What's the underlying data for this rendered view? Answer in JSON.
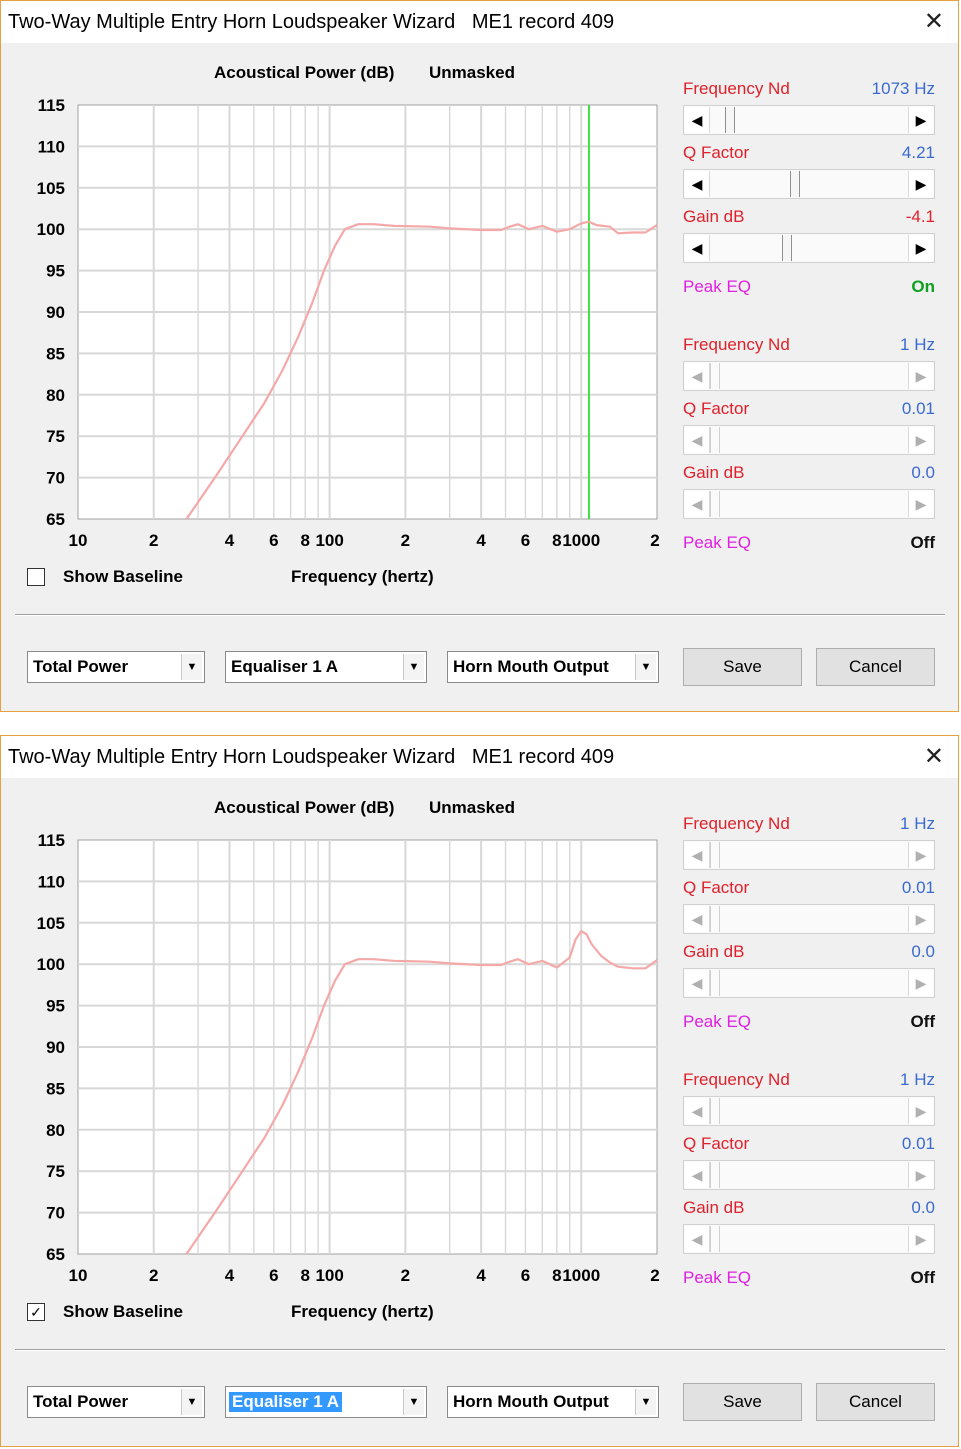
{
  "windows": [
    {
      "title": "Two-Way Multiple Entry Horn Loudspeaker Wizard   ME1 record 409",
      "chart_header": {
        "quantity": "Acoustical Power (dB)",
        "mode": "Unmasked"
      },
      "x_axis_title": "Frequency (hertz)",
      "show_baseline": {
        "label": "Show Baseline",
        "checked": false,
        "mark": ""
      },
      "eq1": {
        "frequency": {
          "label": "Frequency  Nd",
          "value": "1073 Hz",
          "position": 0.08,
          "enabled": true
        },
        "q_factor": {
          "label": "Q Factor",
          "value": "4.21",
          "position": 0.42,
          "enabled": true
        },
        "gain": {
          "label": "Gain  dB",
          "value": "-4.1",
          "position": 0.38,
          "enabled": true
        },
        "peak_eq": {
          "label": "Peak EQ",
          "state": "On"
        }
      },
      "eq2": {
        "frequency": {
          "label": "Frequency  Nd",
          "value": "1 Hz",
          "position": 0.0,
          "enabled": false
        },
        "q_factor": {
          "label": "Q Factor",
          "value": "0.01",
          "position": 0.0,
          "enabled": false
        },
        "gain": {
          "label": "Gain  dB",
          "value": "0.0",
          "position": 0.0,
          "enabled": false
        },
        "peak_eq": {
          "label": "Peak EQ",
          "state": "Off"
        }
      },
      "combos": [
        {
          "value": "Total Power",
          "selected": false
        },
        {
          "value": "Equaliser 1 A",
          "selected": false
        },
        {
          "value": "Horn Mouth Output",
          "selected": false
        }
      ],
      "buttons": {
        "save": "Save",
        "cancel": "Cancel"
      }
    },
    {
      "title": "Two-Way Multiple Entry Horn Loudspeaker Wizard   ME1 record 409",
      "chart_header": {
        "quantity": "Acoustical Power (dB)",
        "mode": "Unmasked"
      },
      "x_axis_title": "Frequency (hertz)",
      "show_baseline": {
        "label": "Show Baseline",
        "checked": true,
        "mark": "✓"
      },
      "eq1": {
        "frequency": {
          "label": "Frequency  Nd",
          "value": "1 Hz",
          "position": 0.0,
          "enabled": false
        },
        "q_factor": {
          "label": "Q Factor",
          "value": "0.01",
          "position": 0.0,
          "enabled": false
        },
        "gain": {
          "label": "Gain  dB",
          "value": "0.0",
          "position": 0.0,
          "enabled": false
        },
        "peak_eq": {
          "label": "Peak EQ",
          "state": "Off"
        }
      },
      "eq2": {
        "frequency": {
          "label": "Frequency  Nd",
          "value": "1 Hz",
          "position": 0.0,
          "enabled": false
        },
        "q_factor": {
          "label": "Q Factor",
          "value": "0.01",
          "position": 0.0,
          "enabled": false
        },
        "gain": {
          "label": "Gain  dB",
          "value": "0.0",
          "position": 0.0,
          "enabled": false
        },
        "peak_eq": {
          "label": "Peak EQ",
          "state": "Off"
        }
      },
      "combos": [
        {
          "value": "Total Power",
          "selected": false
        },
        {
          "value": "Equaliser 1 A",
          "selected": true
        },
        {
          "value": "Horn Mouth Output",
          "selected": false
        }
      ],
      "buttons": {
        "save": "Save",
        "cancel": "Cancel"
      }
    }
  ],
  "colors": {
    "curve": "#f4a8a8",
    "marker": "#40e040",
    "grid": "#d8d8d8",
    "label_red": "#e0202a",
    "value_blue": "#3a6ad0",
    "peak_magenta": "#e020e0",
    "on_green": "#10a020"
  },
  "chart_data": [
    {
      "type": "line",
      "x_scale": "log",
      "xlim": [
        10,
        2000
      ],
      "ylim": [
        65,
        115
      ],
      "y_ticks": [
        65,
        70,
        75,
        80,
        85,
        90,
        95,
        100,
        105,
        110,
        115
      ],
      "x_ticks": [
        10,
        20,
        40,
        60,
        80,
        100,
        200,
        400,
        600,
        800,
        1000,
        2000
      ],
      "x_tick_labels": [
        "10",
        "2",
        "4",
        "6",
        "8",
        "100",
        "2",
        "4",
        "6",
        "8",
        "1000",
        "2"
      ],
      "marker_x": 1073,
      "series": [
        {
          "x": [
            27,
            35,
            45,
            55,
            65,
            75,
            85,
            95,
            105,
            115,
            130,
            150,
            180,
            250,
            300,
            400,
            480,
            520,
            560,
            620,
            700,
            800,
            900,
            1000,
            1073,
            1150,
            1300,
            1400,
            1600,
            1800,
            2000
          ],
          "y": [
            65,
            70,
            75,
            79,
            83,
            87,
            91,
            95,
            98,
            100,
            100.6,
            100.6,
            100.4,
            100.3,
            100.1,
            99.9,
            99.9,
            100.3,
            100.6,
            100.0,
            100.4,
            99.7,
            100.0,
            100.7,
            100.9,
            100.5,
            100.3,
            99.5,
            99.6,
            99.6,
            100.5
          ]
        }
      ]
    },
    {
      "type": "line",
      "x_scale": "log",
      "xlim": [
        10,
        2000
      ],
      "ylim": [
        65,
        115
      ],
      "y_ticks": [
        65,
        70,
        75,
        80,
        85,
        90,
        95,
        100,
        105,
        110,
        115
      ],
      "x_ticks": [
        10,
        20,
        40,
        60,
        80,
        100,
        200,
        400,
        600,
        800,
        1000,
        2000
      ],
      "x_tick_labels": [
        "10",
        "2",
        "4",
        "6",
        "8",
        "100",
        "2",
        "4",
        "6",
        "8",
        "1000",
        "2"
      ],
      "series": [
        {
          "x": [
            27,
            35,
            45,
            55,
            65,
            75,
            85,
            95,
            105,
            115,
            130,
            150,
            180,
            250,
            300,
            400,
            480,
            520,
            560,
            620,
            700,
            800,
            900,
            950,
            1000,
            1050,
            1100,
            1200,
            1300,
            1400,
            1600,
            1800,
            2000
          ],
          "y": [
            65,
            70,
            75,
            79,
            83,
            87,
            91,
            95,
            98,
            100,
            100.6,
            100.6,
            100.4,
            100.3,
            100.1,
            99.9,
            99.9,
            100.3,
            100.6,
            100.0,
            100.4,
            99.6,
            100.8,
            103.0,
            104.0,
            103.6,
            102.4,
            101.0,
            100.2,
            99.7,
            99.5,
            99.5,
            100.5
          ]
        }
      ]
    }
  ]
}
